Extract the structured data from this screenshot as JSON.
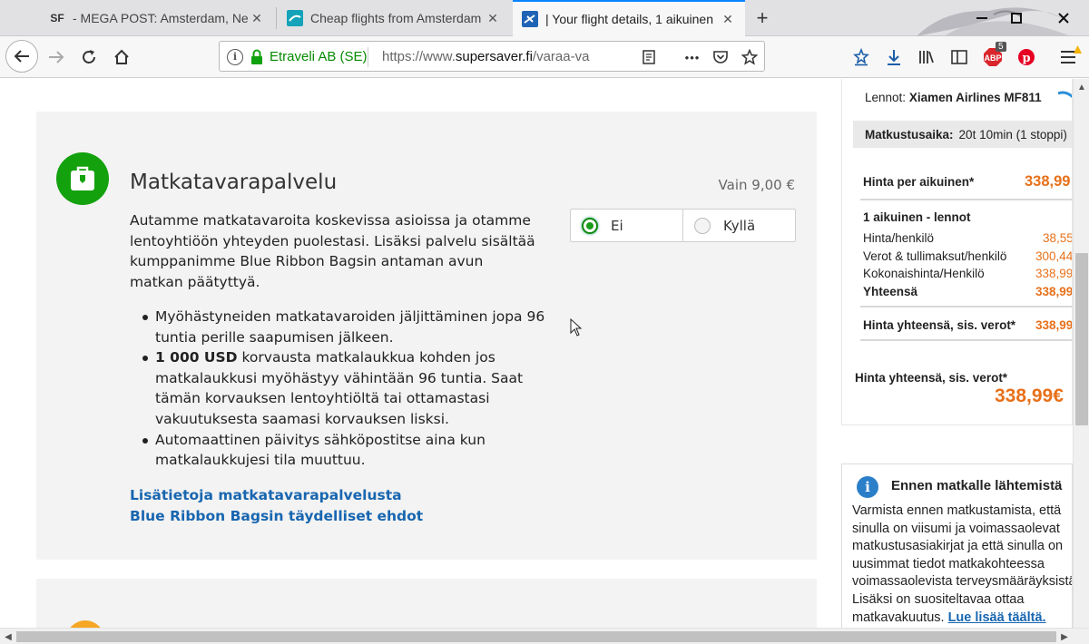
{
  "tabs": [
    {
      "icon_text": "SF",
      "title": "- MEGA POST: Amsterdam, Ne",
      "close": "✕"
    },
    {
      "icon_text": "",
      "title": "Cheap flights from Amsterdam",
      "close": "✕"
    },
    {
      "icon_text": "",
      "title": "| Your flight details, 1 aikuinen",
      "close": "✕"
    }
  ],
  "toolbar": {
    "identity": "Etraveli AB (SE)",
    "url_prefix": "https://www.",
    "url_domain": "supersaver.fi",
    "url_rest": "/varaa-va",
    "more": "•••",
    "adblock_badge": "5"
  },
  "service": {
    "title": "Matkatavarapalvelu",
    "price": "Vain 9,00 €",
    "description": "Autamme matkatavaroita koskevissa asioissa ja otamme lentoyhtiöön yhteyden puolestasi. Lisäksi palvelu sisältää kumppanimme Blue Ribbon Bagsin antaman avun matkan päätyttyä.",
    "bullet1": "Myöhästyneiden matkatavaroiden jäljittäminen jopa 96 tuntia perille saapumisen jälkeen.",
    "bullet2_bold": "1 000 USD",
    "bullet2_rest": " korvausta matkalaukkua kohden jos matkalaukkusi myöhästyy vähintään 96 tuntia. Saat tämän korvauksen lentoyhtiöltä tai ottamastasi vakuutuksesta saamasi korvauksen lisksi.",
    "bullet3": "Automaattinen päivitys sähköpostitse aina kun matkalaukkujesi tila muuttuu.",
    "link1": "Lisätietoja matkatavarapalvelusta",
    "link2": "Blue Ribbon Bagsin täydelliset ehdot",
    "option_no": "Ei",
    "option_yes": "Kyllä",
    "selected": "Ei"
  },
  "summary": {
    "airline_label": "Lennot:",
    "airline_value": "Xiamen Airlines MF811",
    "duration_label": "Matkustusaika:",
    "duration_value": "20t 10min (1 stoppi)",
    "price_per_adult_label": "Hinta per aikuinen*",
    "price_per_adult_value": "338,99",
    "group_heading": "1 aikuinen - lennot",
    "rows": [
      {
        "label": "Hinta/henkilö",
        "value": "38,55"
      },
      {
        "label": "Verot & tullimaksut/henkilö",
        "value": "300,44"
      },
      {
        "label": "Kokonaishinta/Henkilö",
        "value": "338,99"
      },
      {
        "label": "Yhteensä",
        "value": "338,99"
      }
    ],
    "total_incl_label": "Hinta yhteensä, sis. verot*",
    "total_incl_value": "338,99",
    "grand_total_label": "Hinta yhteensä, sis. verot*",
    "grand_total_value": "338,99€"
  },
  "info_box": {
    "title": "Ennen matkalle lähtemistä",
    "text": "Varmista ennen matkustamista, että sinulla on viisumi ja voimassaolevat matkustusasiakirjat ja että sinulla on uusimmat tiedot matkakohteessa voimassaolevista terveysmääräyksistä. Lisäksi on suositeltavaa ottaa matkavakuutus. ",
    "link": "Lue lisää täältä."
  },
  "colors": {
    "accent_tab": "#0a84ff",
    "service_green": "#13a10e",
    "price_orange": "#e8701a",
    "link_blue": "#1866b0"
  }
}
